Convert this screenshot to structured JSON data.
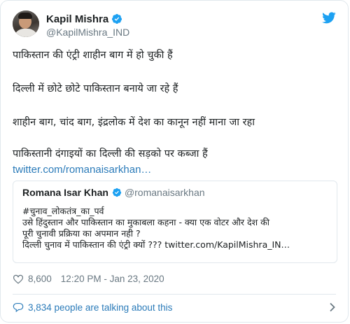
{
  "tweet": {
    "author": {
      "name": "Kapil Mishra",
      "handle": "@KapilMishra_IND",
      "verified": true
    },
    "paragraphs": [
      "पाकिस्तान की एंट्री शाहीन बाग में हो चुकी हैं",
      "दिल्ली में छोटे छोटे पाकिस्तान बनाये जा रहे हैं",
      "शाहीन बाग, चांद बाग, इंद्रलोक में देश का कानून नहीं माना जा रहा",
      "पाकिस्तानी दंगाइयों का दिल्ली की सड़को पर कब्जा हैं"
    ],
    "link_text": "twitter.com/romanaisarkhan…",
    "quoted": {
      "name": "Romana Isar Khan",
      "handle": "@romanaisarkhan",
      "verified": true,
      "lines": [
        "#चुनाव_लोकतंत्र_का_पर्व",
        "उसे हिंदुस्तान और पाकिस्तान का मुकाबला कहना - क्या एक वोटर और देश की",
        "पूरी चुनावी प्रक्रिया का अपमान नही ?",
        "दिल्ली चुनाव में पाकिस्तान की एंट्री क्यों ??? twitter.com/KapilMishra_IN…"
      ]
    },
    "likes": "8,600",
    "timestamp": "12:20 PM - Jan 23, 2020",
    "talking_about": "3,834 people are talking about this"
  },
  "colors": {
    "link": "#2b7bb9",
    "verified": "#1da1f2",
    "twitter_bird": "#1da1f2",
    "muted": "#697882",
    "border": "#e1e8ed"
  },
  "icons": [
    "verified-badge-icon",
    "twitter-bird-icon",
    "heart-icon",
    "speech-bubble-icon",
    "chevron-right-icon"
  ]
}
